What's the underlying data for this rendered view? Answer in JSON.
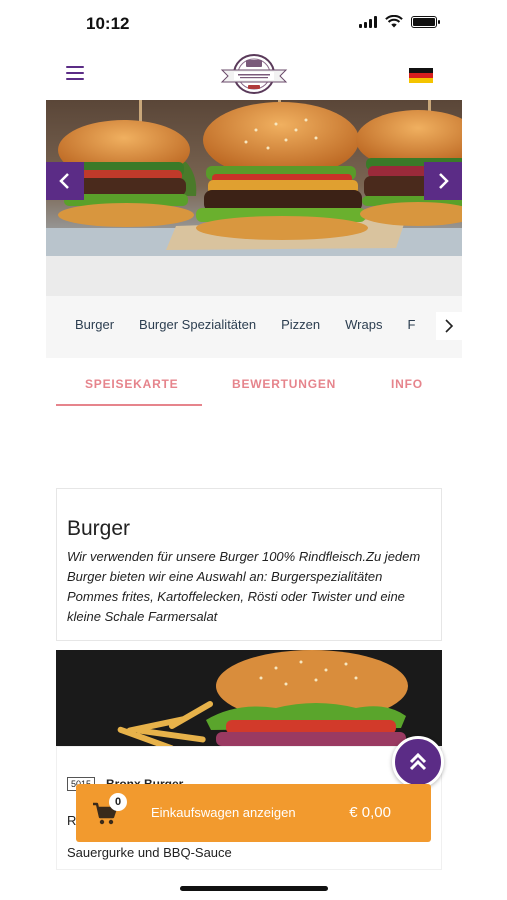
{
  "status_bar": {
    "time": "10:12"
  },
  "colors": {
    "brand_purple": "#5b2c86",
    "tab_accent": "#e6848c",
    "cart_orange": "#f29a2e"
  },
  "header": {
    "logo_icon": "wall-street-logo",
    "menu_icon": "hamburger-menu-icon",
    "language_flag": "german-flag-icon"
  },
  "hero": {
    "prev_icon": "chevron-left-icon",
    "next_icon": "chevron-right-icon"
  },
  "categories": {
    "items": [
      {
        "label": "Burger"
      },
      {
        "label": "Burger Spezialitäten"
      },
      {
        "label": "Pizzen"
      },
      {
        "label": "Wraps"
      },
      {
        "label": "F"
      }
    ]
  },
  "tabs": [
    {
      "label": "SPEISEKARTE",
      "active": true
    },
    {
      "label": "BEWERTUNGEN",
      "active": false
    },
    {
      "label": "INFO",
      "active": false
    }
  ],
  "menu_category": {
    "title": "Burger",
    "description": "Wir verwenden für unsere Burger 100% Rindfleisch.Zu jedem Burger bieten wir eine Auswahl an: Burgerspezialitäten Pommes frites, Kartoffelecken, Rösti oder Twister und eine kleine Schale Farmersalat"
  },
  "product": {
    "code": "5015",
    "name": "Bronx Burger",
    "desc_start": "R",
    "desc_line": "Sauergurke und BBQ-Sauce"
  },
  "cart": {
    "count": "0",
    "label": "Einkaufswagen anzeigen",
    "total": "€ 0,00"
  }
}
